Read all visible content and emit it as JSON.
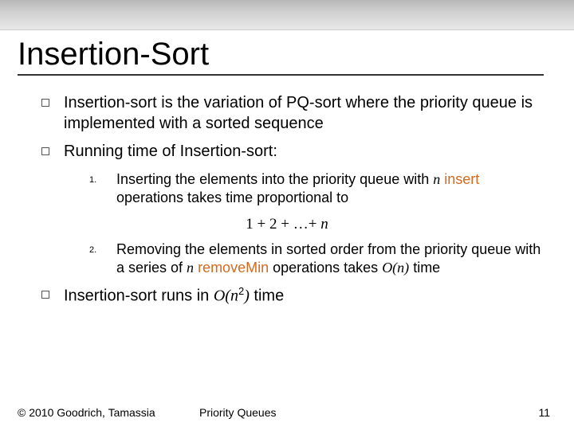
{
  "title": "Insertion-Sort",
  "bullets": [
    "Insertion-sort is the variation of PQ-sort where the priority queue is implemented with a sorted sequence",
    "Running time of Insertion-sort:"
  ],
  "numbered": [
    {
      "marker": "1.",
      "lead": "Inserting the elements into the priority queue with ",
      "nvar": "n",
      "op_word": "insert",
      "tail": " operations takes time proportional to"
    },
    {
      "marker": "2.",
      "lead": "Removing the elements in sorted order from the priority queue with  a series of ",
      "nvar": "n",
      "op_word": "removeMin",
      "tail": " operations takes ",
      "time_expr": "O(n)",
      "tail2": " time"
    }
  ],
  "formula": {
    "text": "1 + 2 + …+ ",
    "nvar": "n"
  },
  "final": {
    "lead": "Insertion-sort runs in ",
    "big_o_open": "O(",
    "nvar": "n",
    "exp": "2",
    "big_o_close": ")",
    "tail": " time"
  },
  "footer": {
    "copyright": "© 2010 Goodrich, Tamassia",
    "center": "Priority Queues",
    "page": "11"
  }
}
